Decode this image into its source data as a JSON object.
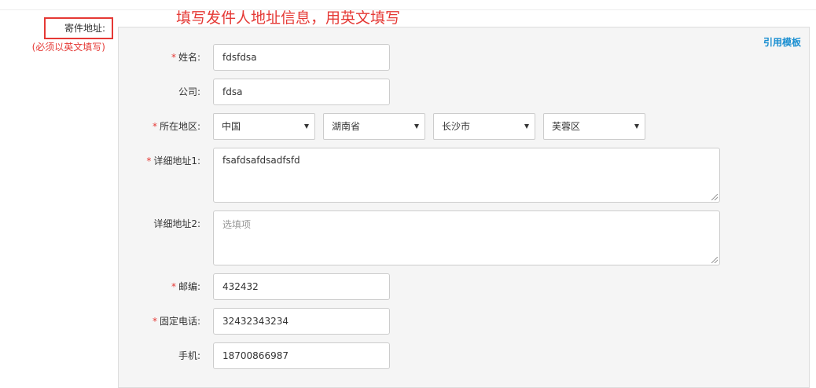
{
  "annotation": {
    "text": "填写发件人地址信息，用英文填写"
  },
  "section": {
    "label": "寄件地址:",
    "note": "(必须以英文填写)"
  },
  "template_link": "引用模板",
  "colors": {
    "required": "#e53935",
    "link": "#1a8fd1",
    "panel_bg": "#f5f5f5"
  },
  "fields": {
    "name": {
      "label": "姓名:",
      "required": "*",
      "value": "fdsfdsa"
    },
    "company": {
      "label": "公司:",
      "value": "fdsa"
    },
    "region": {
      "label": "所在地区:",
      "required": "*",
      "country": "中国",
      "province": "湖南省",
      "city": "长沙市",
      "district": "芙蓉区"
    },
    "address1": {
      "label": "详细地址1:",
      "required": "*",
      "value": "fsafdsafdsadfsfd"
    },
    "address2": {
      "label": "详细地址2:",
      "placeholder": "选填项"
    },
    "postcode": {
      "label": "邮编:",
      "required": "*",
      "value": "432432"
    },
    "phone": {
      "label": "固定电话:",
      "required": "*",
      "value": "32432343234"
    },
    "mobile": {
      "label": "手机:",
      "value": "18700866987"
    }
  }
}
